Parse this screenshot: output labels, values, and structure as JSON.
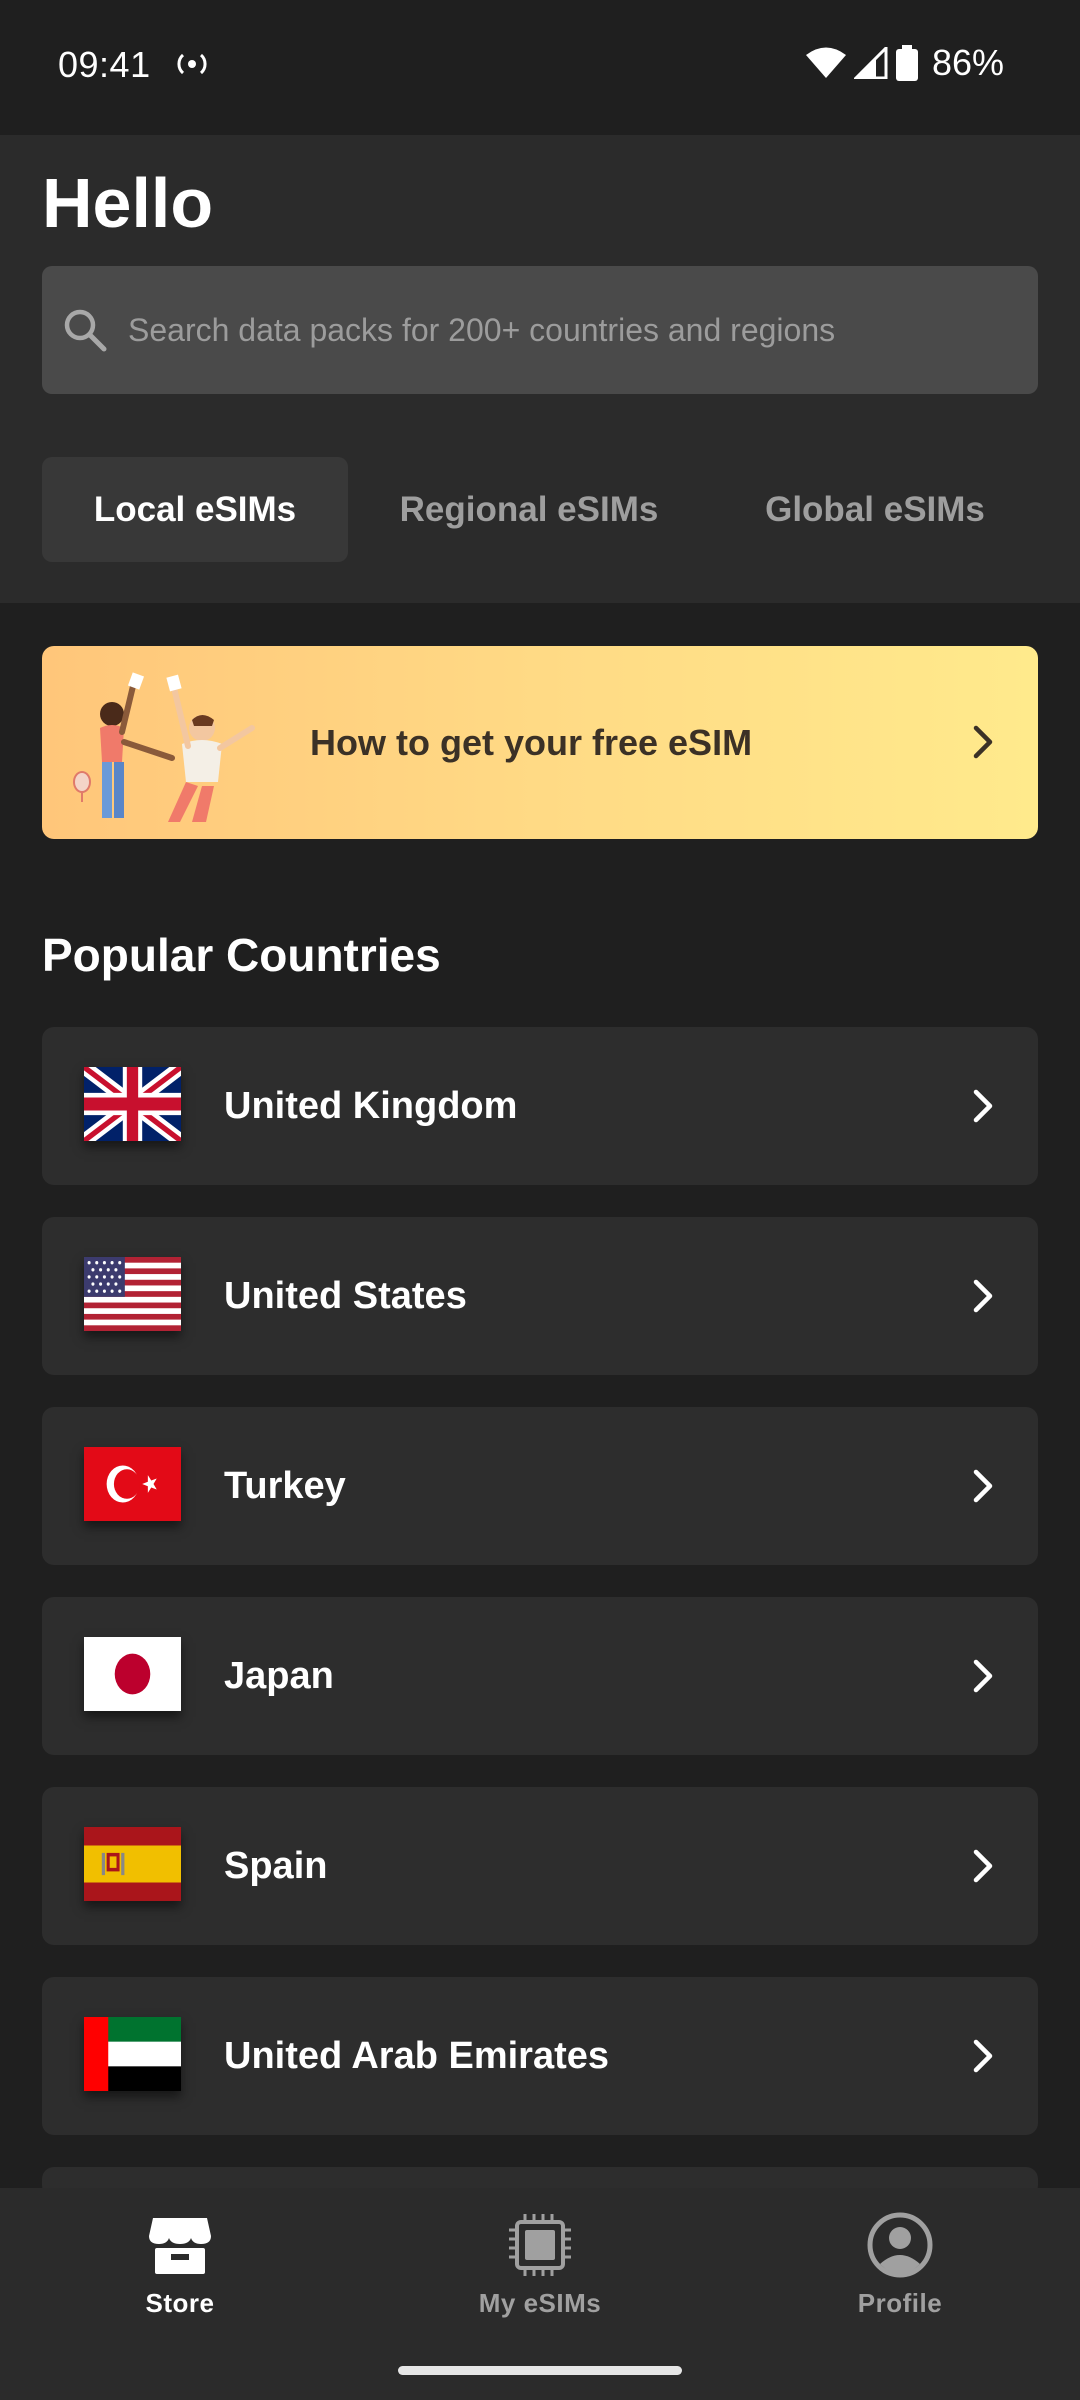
{
  "status_bar": {
    "time": "09:41",
    "battery": "86%",
    "icons": [
      "hotspot-icon",
      "wifi-icon",
      "signal-icon",
      "battery-icon"
    ]
  },
  "header": {
    "greeting": "Hello",
    "search_placeholder": "Search data packs for 200+ countries and regions"
  },
  "tabs": [
    {
      "label": "Local eSIMs",
      "active": true
    },
    {
      "label": "Regional eSIMs",
      "active": false
    },
    {
      "label": "Global eSIMs",
      "active": false
    }
  ],
  "banner": {
    "text": "How to get your free eSIM",
    "colors": [
      "#ffc67a",
      "#ffea8c"
    ]
  },
  "popular": {
    "title": "Popular Countries",
    "countries": [
      {
        "name": "United Kingdom",
        "flag": "uk-flag-icon"
      },
      {
        "name": "United States",
        "flag": "us-flag-icon"
      },
      {
        "name": "Turkey",
        "flag": "turkey-flag-icon"
      },
      {
        "name": "Japan",
        "flag": "japan-flag-icon"
      },
      {
        "name": "Spain",
        "flag": "spain-flag-icon"
      },
      {
        "name": "United Arab Emirates",
        "flag": "uae-flag-icon"
      }
    ]
  },
  "bottom_nav": {
    "items": [
      {
        "label": "Store",
        "icon": "store-icon",
        "active": true
      },
      {
        "label": "My eSIMs",
        "icon": "sim-chip-icon",
        "active": false
      },
      {
        "label": "Profile",
        "icon": "profile-icon",
        "active": false
      }
    ]
  },
  "theme": {
    "background": "#1f1f1f",
    "surface": "#2d2d2d",
    "text_muted": "#9e9e9e"
  }
}
